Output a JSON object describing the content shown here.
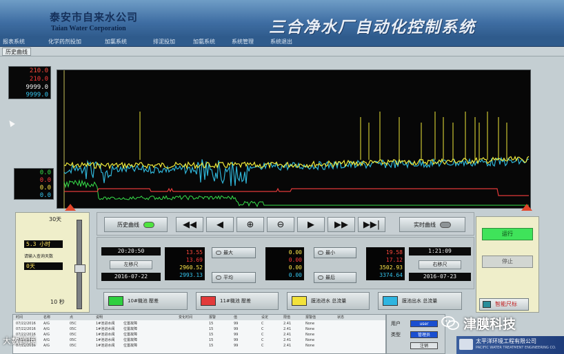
{
  "header": {
    "company_cn": "泰安市自来水公司",
    "company_en": "Taian Water Corporation",
    "system_title": "三合净水厂自动化控制系统"
  },
  "menu": {
    "items": [
      "报表系统",
      "化学药剂投加",
      "加氯系统",
      "排泥投加",
      "加氨系统",
      "系统管理",
      "系统退出"
    ]
  },
  "tab": {
    "label": "历史曲线"
  },
  "scales": {
    "top": [
      {
        "value": "210.0",
        "color": "#ff4a3d"
      },
      {
        "value": "210.0",
        "color": "#ff3a3a"
      },
      {
        "value": "9999.0",
        "color": "#f5f5f5"
      },
      {
        "value": "9999.0",
        "color": "#35c6f0"
      }
    ],
    "bottom": [
      {
        "value": "0.0",
        "color": "#37e04a"
      },
      {
        "value": "0.0",
        "color": "#ff4040"
      },
      {
        "value": "0.0",
        "color": "#ffe84a"
      },
      {
        "value": "0.0",
        "color": "#35c6f0"
      }
    ]
  },
  "duration_panel": {
    "max_label": "30天",
    "hours_value": "5.3 小时",
    "prompt": "请输入查询天数",
    "days_value": "0天",
    "min_label": "10 秒"
  },
  "playback": {
    "history_label": "历史曲线",
    "realtime_label": "实时曲线",
    "buttons": [
      "◀◀",
      "◀",
      "⊕",
      "⊖",
      "▶",
      "▶▶",
      "▶▶|"
    ]
  },
  "data_panel": {
    "start_time": "20:20:50",
    "start_date": "2016-07-22",
    "left_shift": "左移尺",
    "right_time": "1:21:09",
    "right_date": "2016-07-23",
    "right_shift": "右移尺",
    "values_col1": [
      "13.55",
      "13.69",
      "2960.52",
      "2993.13"
    ],
    "values_col2": [
      "0.00",
      "0.00",
      "0.00",
      "0.00"
    ],
    "values_col3": [
      "19.58",
      "17.12",
      "3502.93",
      "3374.64"
    ],
    "btn_max1": "最大",
    "btn_avg": "平均",
    "btn_min": "最小",
    "btn_end": "最后"
  },
  "tags": [
    {
      "label": "10#機池    壓差",
      "color": "#2fd040"
    },
    {
      "label": "11#機池    壓差",
      "color": "#e23a3a"
    },
    {
      "label": "膜池进水    总流量",
      "color": "#f3e23a"
    },
    {
      "label": "膜池出水    总流量",
      "color": "#2fb5e0"
    }
  ],
  "status": {
    "run": "运行",
    "stop": "停止",
    "smart_rule": "智能尺标"
  },
  "log": {
    "headers": [
      "时间",
      "名称",
      "点",
      "说明",
      "变化时间",
      "报警",
      "值",
      "设定",
      "限值",
      "报警值",
      "状态"
    ],
    "rows": [
      [
        "07/22/2016",
        "A/G",
        "05C",
        "1#池进水阀",
        "位置故障",
        "15",
        "99",
        "C",
        "2.41",
        "None"
      ],
      [
        "07/22/2016",
        "A/G",
        "05C",
        "1#池进水阀",
        "位置故障",
        "15",
        "99",
        "C",
        "2.41",
        "None"
      ],
      [
        "07/22/2016",
        "A/G",
        "05C",
        "1#池进水阀",
        "位置故障",
        "15",
        "99",
        "C",
        "2.41",
        "None"
      ],
      [
        "07/22/2016",
        "A/G",
        "05C",
        "1#池进水阀",
        "位置故障",
        "15",
        "99",
        "C",
        "2.41",
        "None"
      ],
      [
        "07/22/2016",
        "A/G",
        "05C",
        "1#池进水阀",
        "位置故障",
        "15",
        "99",
        "C",
        "2.41",
        "None"
      ]
    ]
  },
  "log_side": {
    "user_label": "用户",
    "user_value": "user",
    "type_label": "类型",
    "type_value": "管理员",
    "login_label": "注销"
  },
  "footer": {
    "company": "太平洋环境工程有限公司",
    "sub": "PACIFIC WATER TREATMENT ENGINEERING CO."
  },
  "watermarks": {
    "right": "津膜科技",
    "left": "大数跨境"
  },
  "colors": {
    "header_blue": "#3f6ea3",
    "run_green": "#3fe35a",
    "trend_yellow": "#f0ea3a",
    "trend_cyan": "#2fb5d8",
    "trend_red": "#e23a3a",
    "trend_green": "#37e04a"
  }
}
